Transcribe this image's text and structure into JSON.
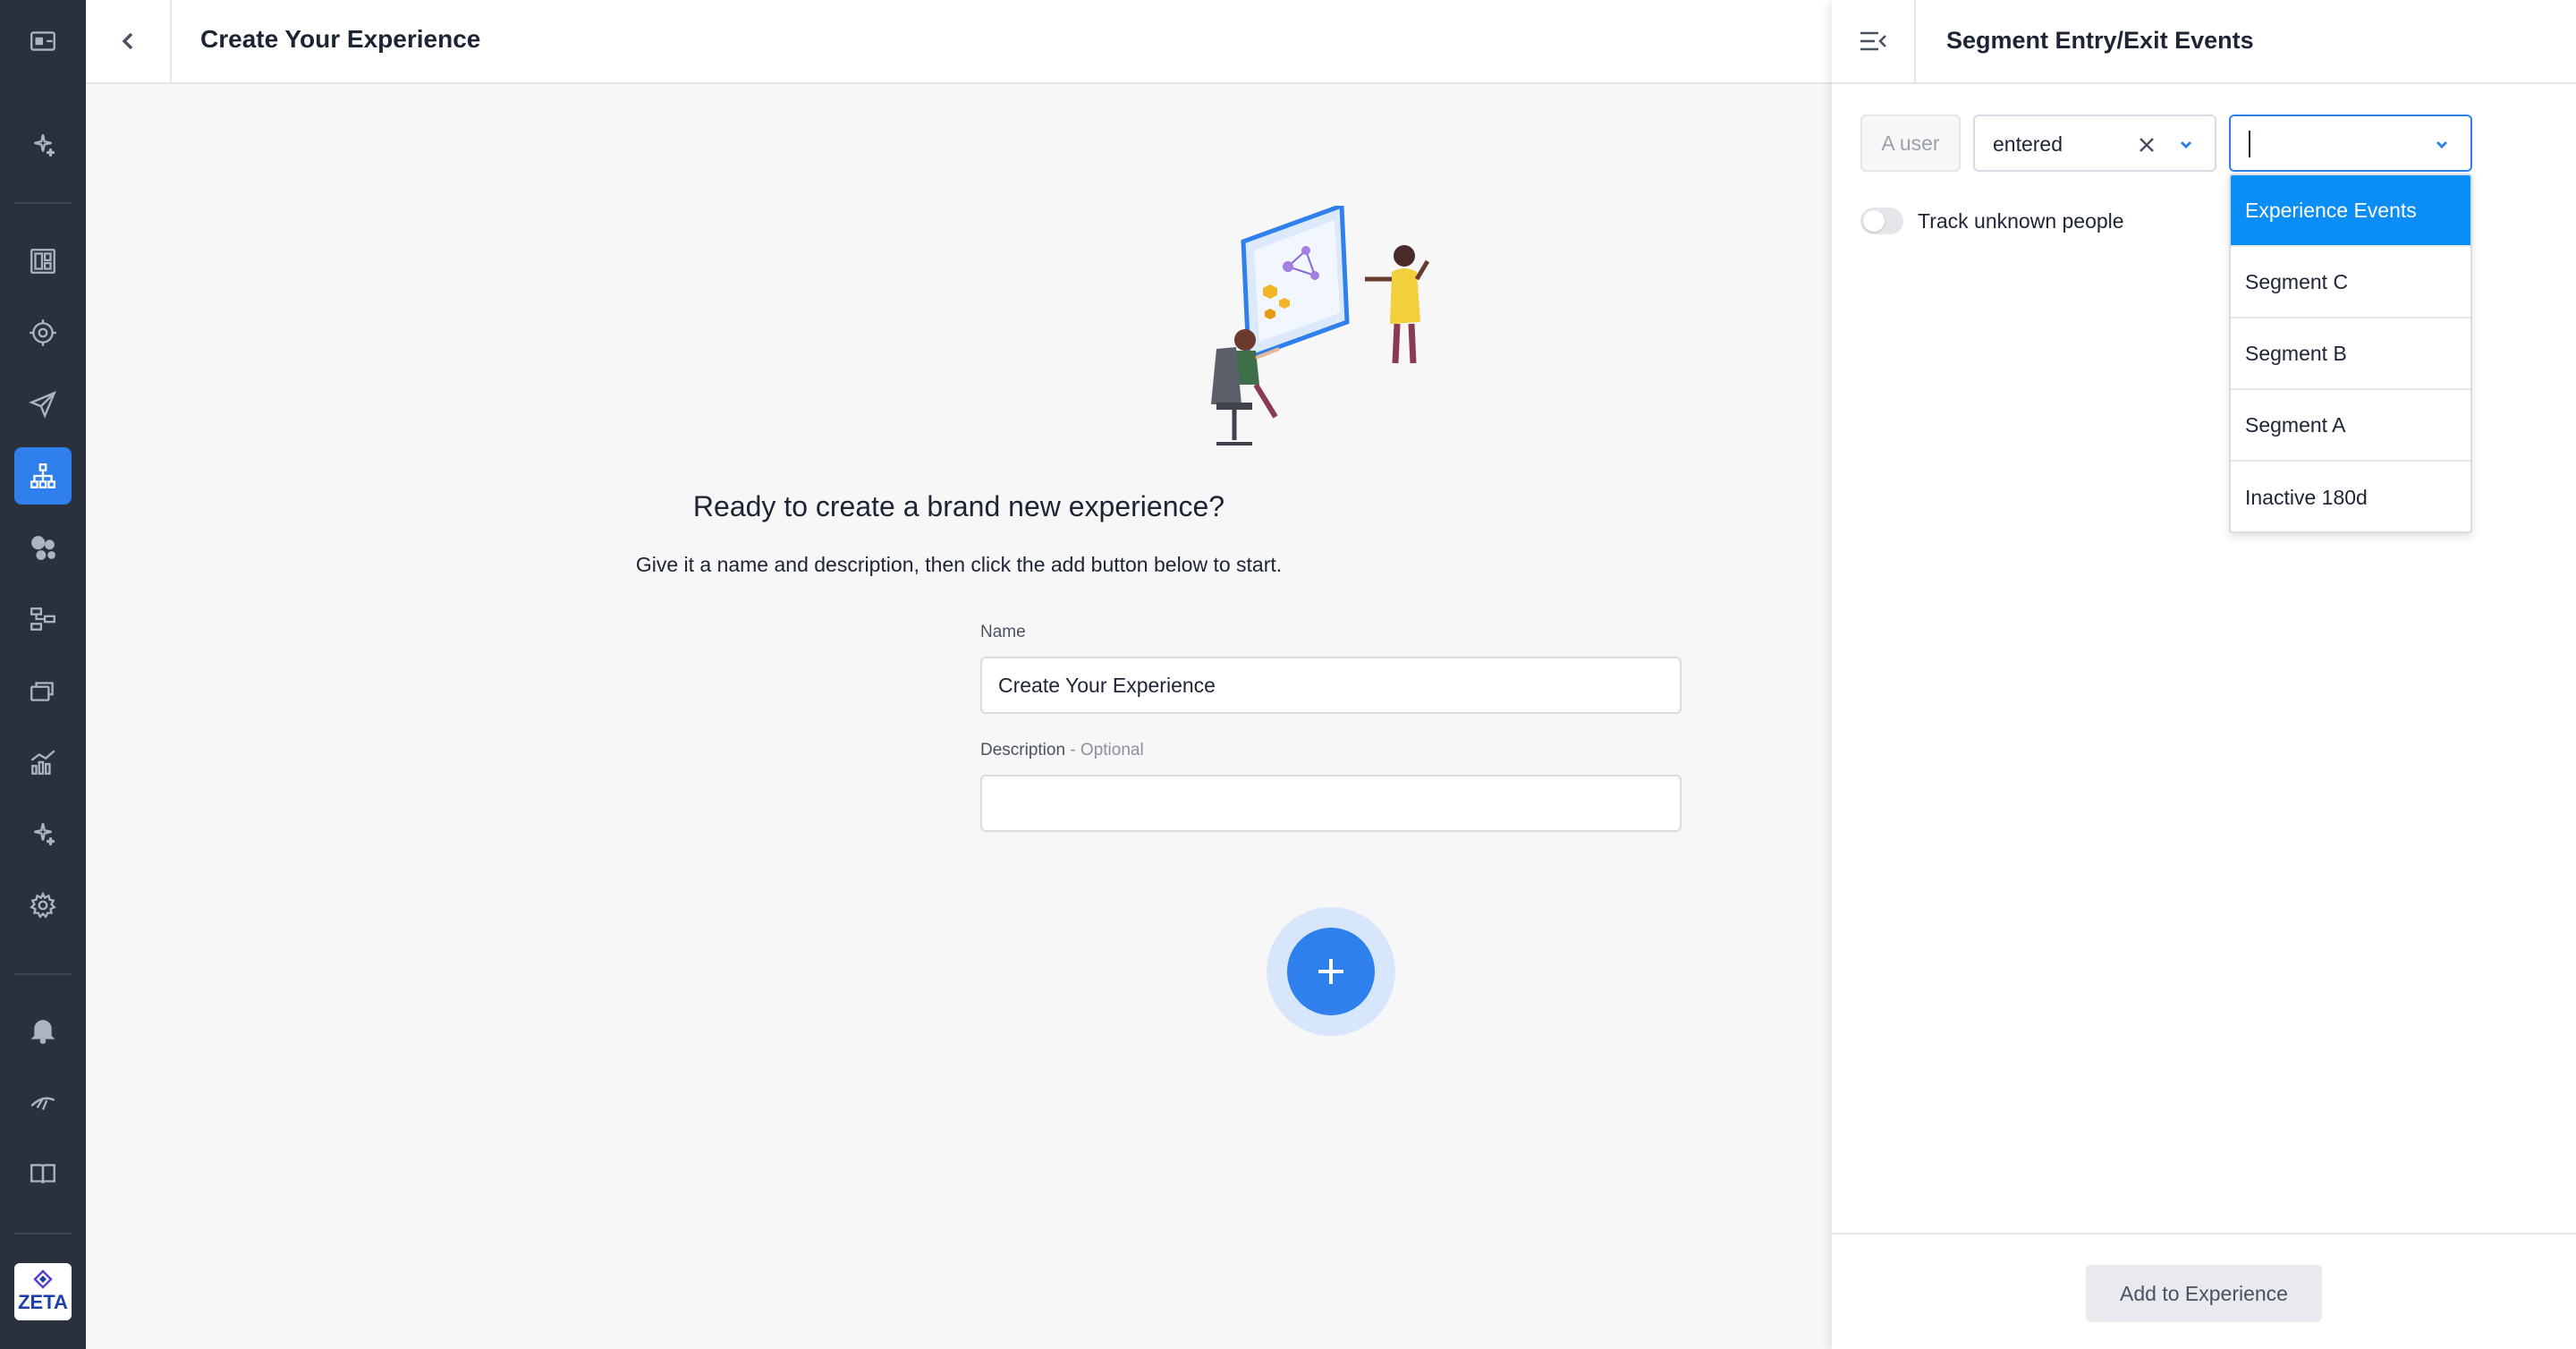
{
  "header": {
    "title": "Create Your Experience"
  },
  "main": {
    "hero_title": "Ready to create a brand new experience?",
    "hero_subtitle": "Give it a name and description, then click the add button below to start.",
    "name_label": "Name",
    "name_value": "Create Your Experience",
    "description_label": "Description",
    "description_optional": " - Optional",
    "description_value": ""
  },
  "panel": {
    "title": "Segment Entry/Exit Events",
    "subject": "A user",
    "action_value": "entered",
    "segment_search_value": "",
    "dropdown_options": [
      {
        "label": "Experience Events",
        "selected": true
      },
      {
        "label": "Segment C",
        "selected": false
      },
      {
        "label": "Segment B",
        "selected": false
      },
      {
        "label": "Segment A",
        "selected": false
      },
      {
        "label": "Inactive 180d",
        "selected": false
      }
    ],
    "track_unknown_label": "Track unknown people",
    "track_unknown_enabled": false,
    "submit_label": "Add to Experience"
  },
  "logo": {
    "text": "ZETA"
  },
  "colors": {
    "sidebar_bg": "#2a303c",
    "accent": "#2f80ed",
    "dropdown_selected": "#0a8df5"
  },
  "sidebar_icons": [
    "collapse-panel-icon",
    "sparkle-icon",
    "dashboard-icon",
    "target-icon",
    "send-icon",
    "hierarchy-icon",
    "audience-icon",
    "flow-icon",
    "stack-icon",
    "analytics-icon",
    "ai-sparkle-icon",
    "settings-icon",
    "bell-icon",
    "signal-icon",
    "book-icon"
  ]
}
